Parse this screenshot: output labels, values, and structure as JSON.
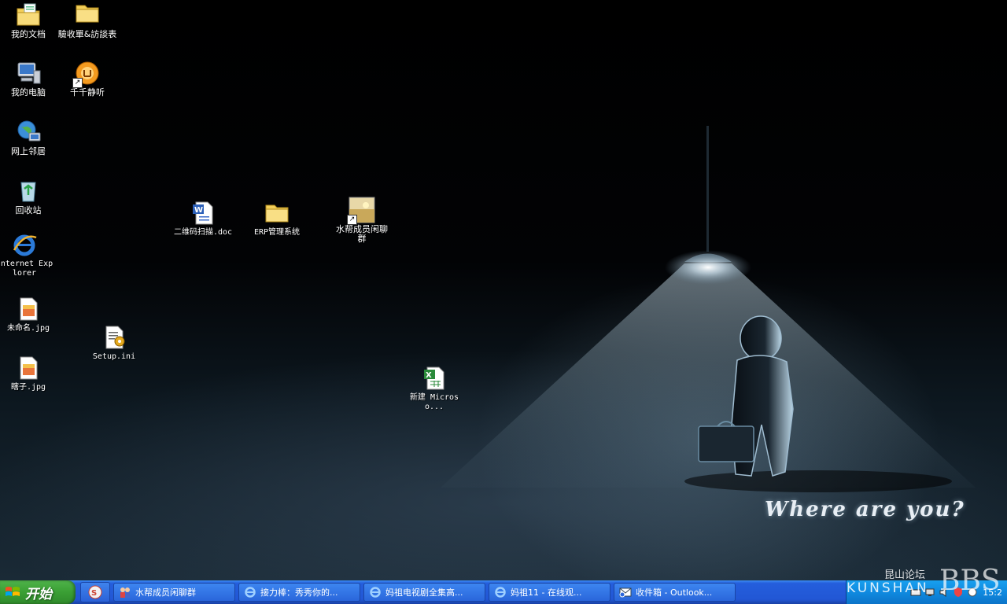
{
  "wallpaper": {
    "caption": "Where are you?"
  },
  "desktop_icons": [
    {
      "label": "我的文档",
      "icon": "documents-folder-icon"
    },
    {
      "label": "驗收單&訪談表",
      "icon": "folder-icon"
    },
    {
      "label": "我的电脑",
      "icon": "computer-icon"
    },
    {
      "label": "千千静听",
      "icon": "music-player-icon"
    },
    {
      "label": "网上邻居",
      "icon": "network-icon"
    },
    {
      "label": "回收站",
      "icon": "recycle-bin-icon"
    },
    {
      "label": "Internet Explorer",
      "icon": "internet-explorer-icon"
    },
    {
      "label": "未命名.jpg",
      "icon": "image-file-icon"
    },
    {
      "label": "Setup.ini",
      "icon": "ini-file-icon"
    },
    {
      "label": "瞎子.jpg",
      "icon": "image-file-icon"
    },
    {
      "label": "二维码扫描.doc",
      "icon": "word-document-icon"
    },
    {
      "label": "ERP管理系统",
      "icon": "folder-icon"
    },
    {
      "label": "水帮成员闲聊群",
      "icon": "image-shortcut-icon"
    },
    {
      "label": "新建 Microso...",
      "icon": "excel-document-icon"
    }
  ],
  "taskbar": {
    "start_label": "开始",
    "colors": {
      "start": "#3a9f34",
      "bar": "#245edc",
      "tray": "#0f8ae0"
    },
    "tasks": [
      {
        "label": "水帮成员闲聊群",
        "icon": "chat-group-icon"
      },
      {
        "label": "接力棒：秀秀你的...",
        "icon": "internet-explorer-icon"
      },
      {
        "label": "妈祖电视剧全集高...",
        "icon": "internet-explorer-icon"
      },
      {
        "label": "妈祖11 - 在线观...",
        "icon": "internet-explorer-icon"
      },
      {
        "label": "收件箱 - Outlook...",
        "icon": "outlook-icon"
      }
    ],
    "clock": "15:2"
  },
  "watermark": {
    "cn": "昆山论坛",
    "en": "KUNSHAN",
    "bbs": "BBS"
  }
}
